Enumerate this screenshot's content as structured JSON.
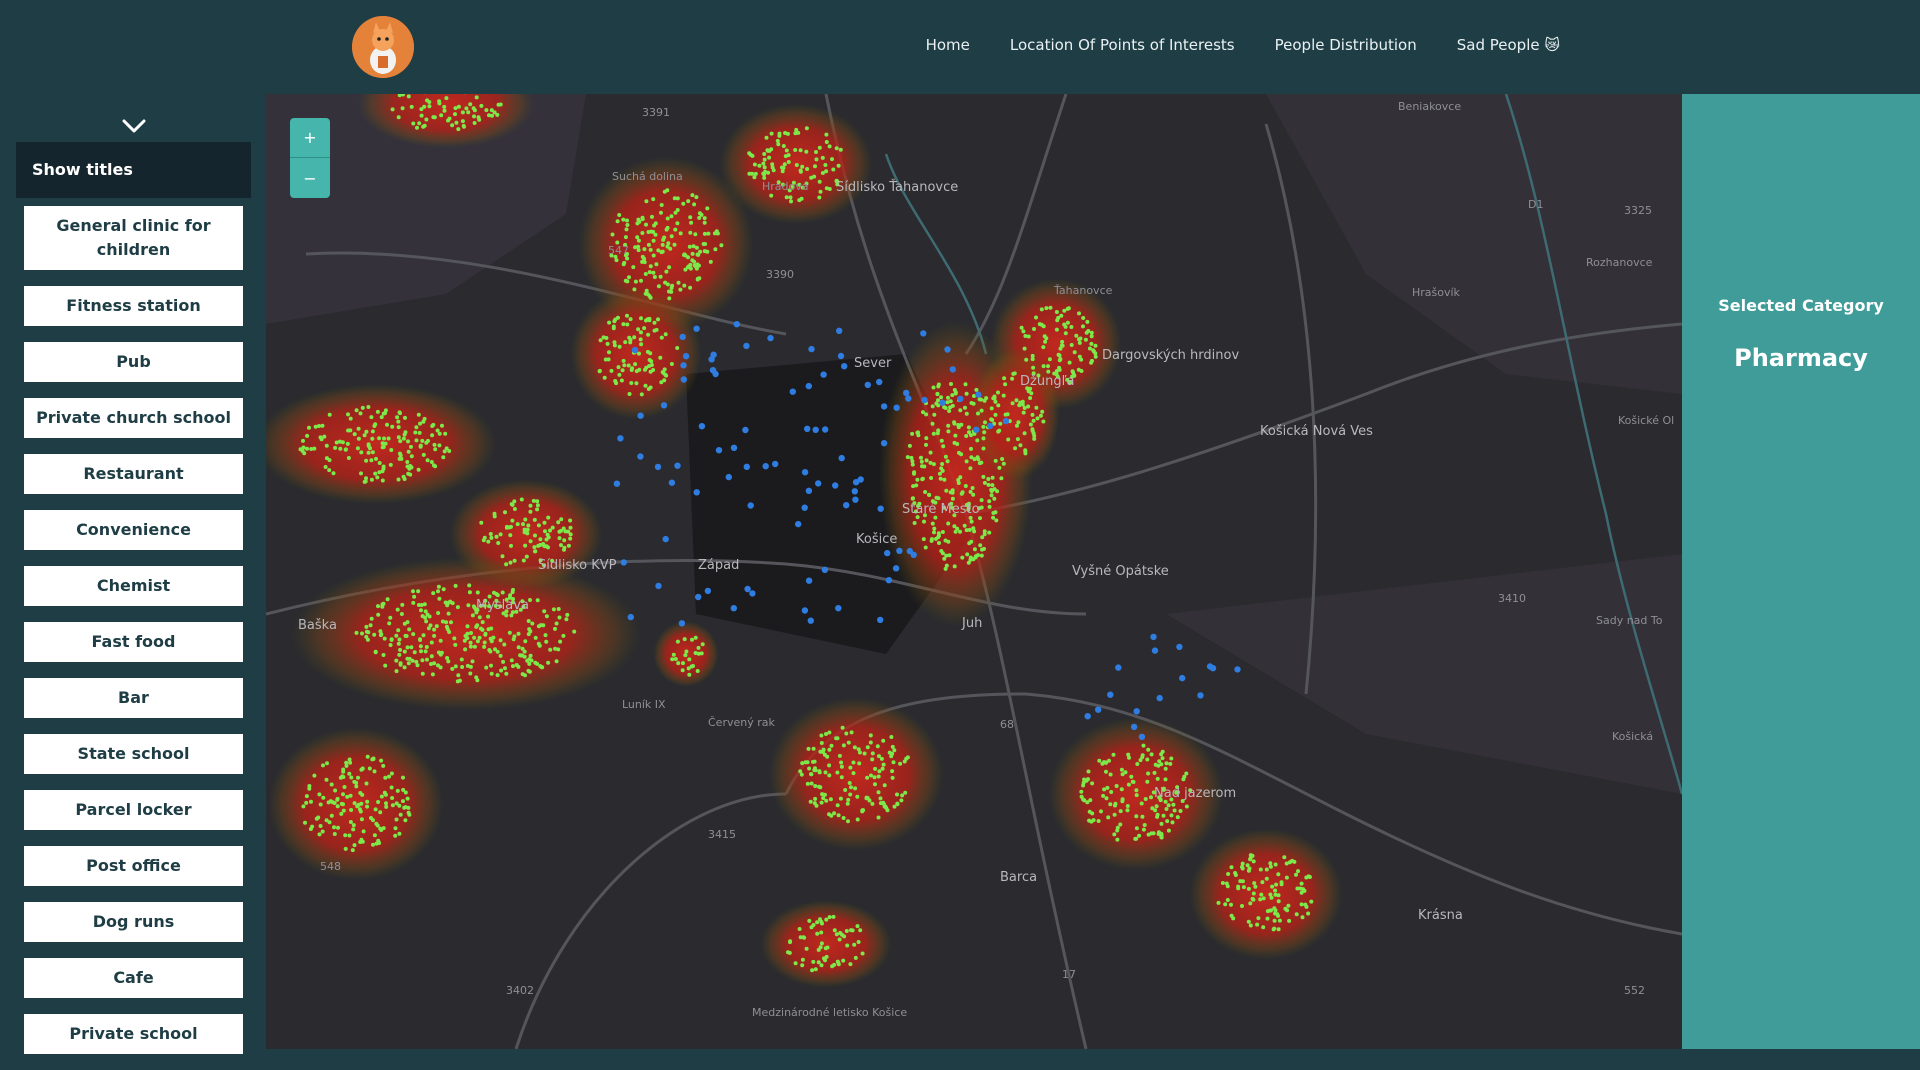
{
  "nav": {
    "items": [
      "Home",
      "Location Of Points of Interests",
      "People Distribution",
      "Sad People 😿"
    ]
  },
  "sidebar": {
    "show_titles": "Show titles",
    "categories": [
      "General clinic for children",
      "Fitness station",
      "Pub",
      "Private church school",
      "Restaurant",
      "Convenience",
      "Chemist",
      "Fast food",
      "Bar",
      "State school",
      "Parcel locker",
      "Post office",
      "Dog runs",
      "Cafe",
      "Private school"
    ]
  },
  "map": {
    "zoom_in": "+",
    "zoom_out": "−",
    "labels": {
      "sidlisko_tahanovce": "Sídlisko Ťahanovce",
      "tahanovce": "Ťahanovce",
      "sever": "Sever",
      "dzungla": "Džungľa",
      "dargovskych_hrdinov": "Dargovských hrdinov",
      "kosicka_nova_ves": "Košická Nová Ves",
      "stare_mesto": "Staré Mesto",
      "kosice": "Košice",
      "sidlisko_kvp": "Sídlisko KVP",
      "zapad": "Západ",
      "myslava": "Myslava",
      "baska": "Baška",
      "vysne_opatske": "Vyšné Opátske",
      "jun": "Juh",
      "lunik": "Luník IX",
      "nad_jazerom": "Nad jazerom",
      "barca": "Barca",
      "krasna": "Krásna",
      "beniakovce": "Beniakovce",
      "hrasovik": "Hrašovík",
      "rozhanovce": "Rozhanovce",
      "sady_nad_torysou": "Sady nad To",
      "kosicke_olsany": "Košické Ol",
      "kosicka_polianka": "Košická",
      "sucha_dolina": "Suchá dolina",
      "hradova": "Hradová",
      "cerveny_rak": "Červený rak",
      "medzinarodne_letisko": "Medzinárodné letisko Košice",
      "r3391": "3391",
      "r547": "547",
      "r3390": "3390",
      "r68": "68",
      "r3415": "3415",
      "r548": "548",
      "r3402": "3402",
      "r17": "17",
      "r552": "552",
      "r3410": "3410",
      "r3325": "3325",
      "rd1": "D1"
    }
  },
  "panel": {
    "title": "Selected Category",
    "value": "Pharmacy"
  },
  "colors": {
    "header_bg": "#1f3d45",
    "panel_bg": "#3f9c98",
    "heat_red": "#c8281e",
    "people_green": "#7de84a",
    "poi_blue": "#2f7de0"
  }
}
